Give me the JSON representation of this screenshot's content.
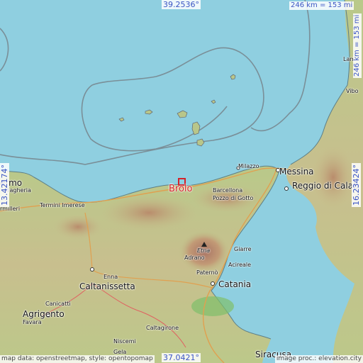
{
  "map": {
    "center_lat": "39.2536°",
    "bottom_lat": "37.0421°",
    "left_lon": "13.42174°",
    "right_lon": "16.23424°",
    "scale_top": "246 km = 153 mi",
    "scale_right": "246 km = 153 mi",
    "credit_left": "map data: openstreetmap, style: opentopomap",
    "credit_right": "image proc.: elevation.city",
    "marker_label": "Brolo",
    "colors": {
      "sea": "#8fcfe0",
      "marker": "#d2232a",
      "coord_text": "#3b55c4"
    },
    "places": {
      "palermo": "ermo",
      "bagheria": "Bagheria",
      "termini": "Termini Imerese",
      "rmilleri": "rmilleri",
      "milazzo": "Milazzo",
      "messina": "Messina",
      "barcellona": "Barcellona\nPozzo di Gotto",
      "reggio": "Reggio di Calab",
      "giarre": "Giarre",
      "acireale": "Acireale",
      "paterno": "Paternò",
      "catania": "Catania",
      "etna": "Etna",
      "adrano": "Adrano",
      "enna": "Enna",
      "caltanissetta": "Caltanissetta",
      "agrigento": "Agrigento",
      "canicatti": "Canicattì",
      "favara": "Favara",
      "caltagirone": "Caltagirone",
      "niscemi": "Niscemi",
      "gela": "Gela",
      "siracusa": "Siracusa",
      "vibo": "Vibo",
      "lam": "Lam"
    }
  }
}
